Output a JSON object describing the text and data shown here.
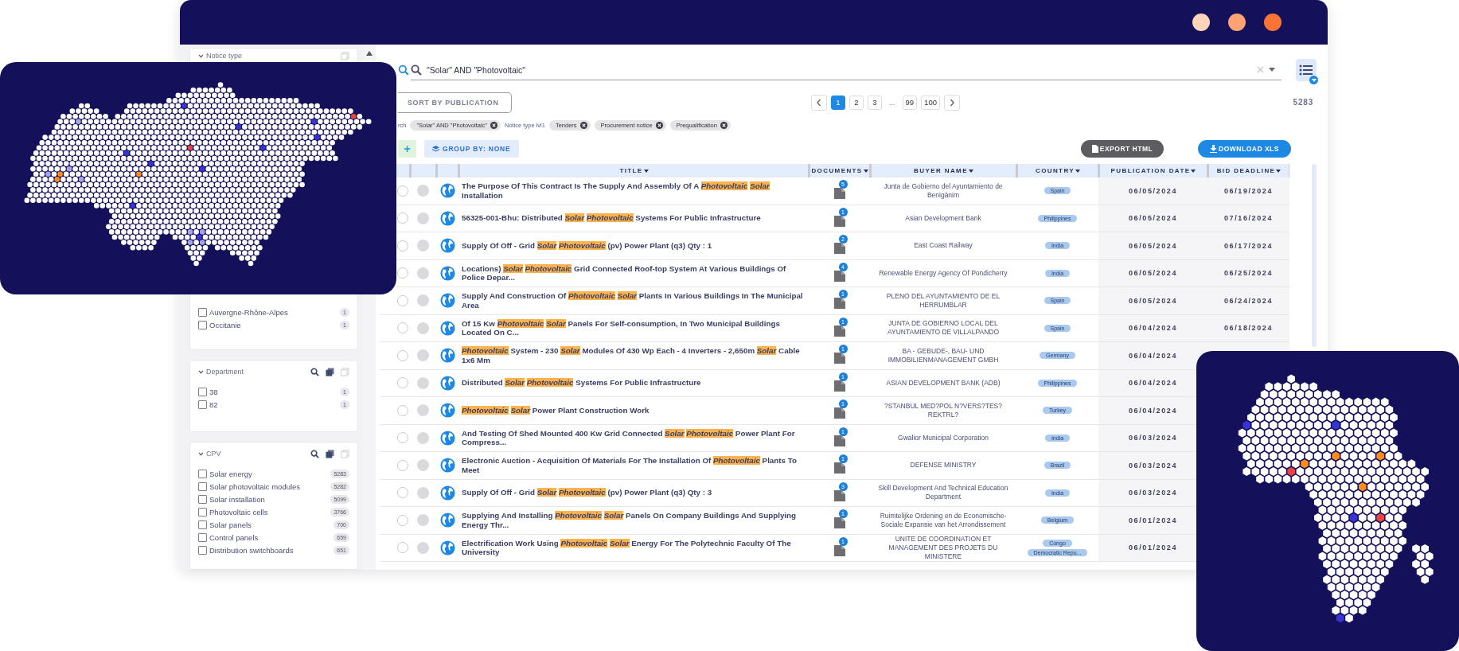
{
  "sidebar": {
    "panels": [
      {
        "kind": "header",
        "title": "Notice type"
      },
      {
        "kind": "list",
        "items": [
          {
            "label": "Auvergne-Rhône-Alpes",
            "count": "1",
            "checked": false
          },
          {
            "label": "Occitanie",
            "count": "1",
            "checked": false
          }
        ]
      },
      {
        "kind": "facet",
        "title": "Department",
        "items": [
          {
            "label": "38",
            "count": "1",
            "checked": false
          },
          {
            "label": "82",
            "count": "1",
            "checked": false
          }
        ]
      },
      {
        "kind": "facet",
        "title": "CPV",
        "items": [
          {
            "label": "Solar energy",
            "count": "5283",
            "checked": false
          },
          {
            "label": "Solar photovoltaic modules",
            "count": "5282",
            "checked": false
          },
          {
            "label": "Solar installation",
            "count": "5099",
            "checked": false
          },
          {
            "label": "Photovoltaic cells",
            "count": "3766",
            "checked": false
          },
          {
            "label": "Solar panels",
            "count": "700",
            "checked": false
          },
          {
            "label": "Control panels",
            "count": "659",
            "checked": false
          },
          {
            "label": "Distribution switchboards",
            "count": "651",
            "checked": false
          }
        ]
      }
    ]
  },
  "search": {
    "query": "\"Solar\" AND \"Photovoltaic\""
  },
  "sort_button": "SORT BY PUBLICATION",
  "pagination": {
    "pages": [
      {
        "kind": "page",
        "label": "1",
        "selected": true
      },
      {
        "kind": "page",
        "label": "2",
        "selected": false
      },
      {
        "kind": "page",
        "label": "3",
        "selected": false
      },
      {
        "kind": "gap",
        "label": "...",
        "selected": false
      },
      {
        "kind": "page",
        "label": "99",
        "selected": false
      },
      {
        "kind": "page",
        "label": "100",
        "selected": false
      }
    ]
  },
  "result_count": "5283",
  "filters": {
    "label": "rch",
    "chips": [
      {
        "kind": "chip",
        "label": "\"Solar\" AND \"Photovoltaic\""
      },
      {
        "kind": "label",
        "label": "Notice type lvl1"
      },
      {
        "kind": "chip",
        "label": "Tenders"
      },
      {
        "kind": "chip",
        "label": "Procurement notice"
      },
      {
        "kind": "chip",
        "label": "Prequalification"
      }
    ]
  },
  "add_button": "+",
  "group_by_button": "GROUP BY: NONE",
  "export_button": "EXPORT HTML",
  "download_button": "DOWNLOAD XLS",
  "table": {
    "columns": [
      "TITLE",
      "DOCUMENTS",
      "BUYER NAME",
      "COUNTRY",
      "PUBLICATION DATE",
      "BID DEADLINE"
    ],
    "rows": [
      {
        "selected": false,
        "title": "The Purpose Of This Contract Is The Supply And Assembly Of A **Photovoltaic** **Solar** Installation",
        "documents": "5",
        "buyer": "Junta de Gobierno del Ayuntamiento de Benigànim",
        "countries": [
          "Spain"
        ],
        "publication_date": "06/05/2024",
        "bid_deadline": "06/19/2024"
      },
      {
        "selected": false,
        "title": "56325-001-Bhu: Distributed **Solar** **Photovoltaic** Systems For Public Infrastructure",
        "documents": "1",
        "buyer": "Asian Development Bank",
        "countries": [
          "Philippines"
        ],
        "publication_date": "06/05/2024",
        "bid_deadline": "07/16/2024"
      },
      {
        "selected": false,
        "title": "Supply Of Off - Grid **Solar** **Photovoltaic** (pv) Power Plant (q3) Qty : 1",
        "documents": "2",
        "buyer": "East Coast Railway",
        "countries": [
          "India"
        ],
        "publication_date": "06/05/2024",
        "bid_deadline": "06/17/2024"
      },
      {
        "selected": false,
        "title": "Locations) **Solar** **Photovoltaic** Grid Connected Roof-top System At Various Buildings Of Police Depar...",
        "documents": "4",
        "buyer": "Renewable Energy Agency Of Pondicherry",
        "countries": [
          "India"
        ],
        "publication_date": "06/05/2024",
        "bid_deadline": "06/25/2024"
      },
      {
        "selected": false,
        "title": "Supply And Construction Of **Photovoltaic** **Solar** Plants In Various Buildings In The Municipal Area",
        "documents": "1",
        "buyer": "PLENO DEL AYUNTAMIENTO DE EL HERRUMBLAR",
        "countries": [
          "Spain"
        ],
        "publication_date": "06/05/2024",
        "bid_deadline": "06/24/2024"
      },
      {
        "selected": false,
        "title": "Of 15 Kw **Photovoltaic** **Solar** Panels For Self-consumption, In Two Municipal Buildings Located On C...",
        "documents": "1",
        "buyer": "JUNTA DE GOBIERNO LOCAL DEL AYUNTAMIENTO DE VILLALPANDO",
        "countries": [
          "Spain"
        ],
        "publication_date": "06/04/2024",
        "bid_deadline": "06/18/2024"
      },
      {
        "selected": false,
        "title": "**Photovoltaic** System - 230 **Solar** Modules Of 430 Wp Each - 4 Inverters - 2,650m **Solar** Cable 1x6 Mm",
        "documents": "1",
        "buyer": "BA - GEBUDE-, BAU- UND IMMOBILIENMANAGEMENT GMBH",
        "countries": [
          "Germany"
        ],
        "publication_date": "06/04/2024"
      },
      {
        "selected": false,
        "title": "Distributed **Solar** **Photovoltaic** Systems For Public Infrastructure",
        "documents": "1",
        "buyer": "ASIAN DEVELOPMENT BANK (ADB)",
        "countries": [
          "Philippines"
        ],
        "publication_date": "06/04/2024"
      },
      {
        "selected": false,
        "title": "**Photovoltaic** **Solar** Power Plant Construction Work",
        "documents": "1",
        "buyer": "?STANBUL MED?POL N?VERS?TES? REKTRL?",
        "countries": [
          "Turkey"
        ],
        "publication_date": "06/04/2024"
      },
      {
        "selected": false,
        "title": "And Testing Of Shed Mounted 400 Kw Grid Connected **Solar** **Photovoltaic** Power Plant For Compress...",
        "documents": "1",
        "buyer": "Gwalior Municipal Corporation",
        "countries": [
          "India"
        ],
        "publication_date": "06/03/2024"
      },
      {
        "selected": false,
        "title": "Electronic Auction - Acquisition Of Materials For The Installation Of **Photovoltaic** Plants To Meet",
        "documents": "1",
        "buyer": "DEFENSE MINISTRY",
        "countries": [
          "Brazil"
        ],
        "publication_date": "06/03/2024"
      },
      {
        "selected": false,
        "title": "Supply Of Off - Grid **Solar** **Photovoltaic** (pv) Power Plant (q3) Qty : 3",
        "documents": "3",
        "buyer": "Skill Development And Technical Education Department",
        "countries": [
          "India"
        ],
        "publication_date": "06/03/2024"
      },
      {
        "selected": false,
        "title": "Supplying And Installing **Photovoltaic** **Solar** Panels On Company Buildings And Supplying Energy Thr...",
        "documents": "1",
        "buyer": "Ruimtelijke Ordening en de Economische-Sociale Expansie van het Arrondissement",
        "countries": [
          "Belgium"
        ],
        "publication_date": "06/01/2024"
      },
      {
        "selected": false,
        "title": "Electrification Work Using **Photovoltaic** **Solar** Energy For The Polytechnic Faculty Of The University",
        "documents": "1",
        "buyer": "UNITE DE COORDINATION ET MANAGEMENT DES PROJETS DU MINISTERE",
        "countries": [
          "Congo",
          "Democratic Repu..."
        ],
        "publication_date": "06/01/2024"
      }
    ]
  }
}
